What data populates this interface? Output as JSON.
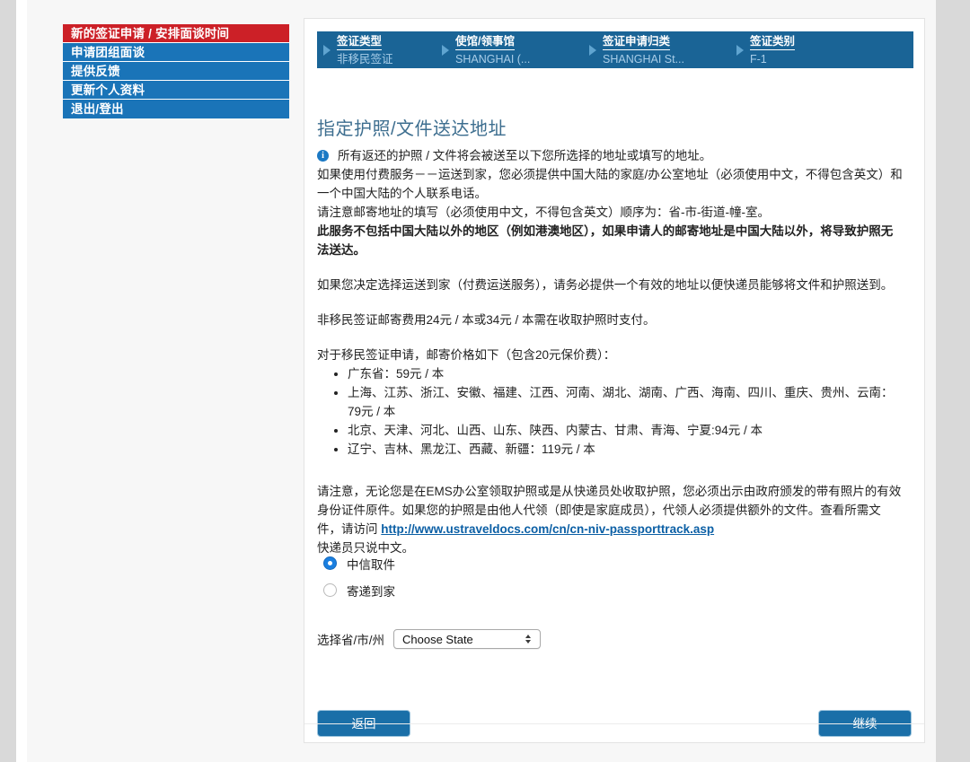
{
  "sidebar": {
    "items": [
      {
        "label": "新的签证申请 / 安排面谈时间",
        "active": true
      },
      {
        "label": "申请团组面谈",
        "active": false
      },
      {
        "label": "提供反馈",
        "active": false
      },
      {
        "label": "更新个人资料",
        "active": false
      },
      {
        "label": "退出/登出",
        "active": false
      }
    ]
  },
  "breadcrumb": {
    "steps": [
      {
        "title": "签证类型",
        "value": "非移民签证"
      },
      {
        "title": "使馆/领事馆",
        "value": "SHANGHAI (..."
      },
      {
        "title": "签证申请归类",
        "value": "SHANGHAI St..."
      },
      {
        "title": "签证类别",
        "value": "F-1"
      }
    ]
  },
  "main": {
    "page_title": "指定护照/文件送达地址",
    "info_icon": "info-icon",
    "info_text": "所有返还的护照 / 文件将会被送至以下您所选择的地址或填写的地址。",
    "para_paid_service": "如果使用付费服务－－运送到家，您必须提供中国大陆的家庭/办公室地址（必须使用中文，不得包含英文）和一个中国大陆的个人联系电话。",
    "para_address_order": "请注意邮寄地址的填写（必须使用中文，不得包含英文）顺序为：省-市-街道-幢-室。",
    "para_mainland_only": "此服务不包括中国大陆以外的地区（例如港澳地区），如果申请人的邮寄地址是中国大陆以外，将导致护照无法送达。",
    "para_valid_address": "如果您决定选择运送到家（付费运送服务），请务必提供一个有效的地址以便快递员能够将文件和护照送到。",
    "para_niv_fee": "非移民签证邮寄费用24元 / 本或34元 / 本需在收取护照时支付。",
    "para_iv_intro": "对于移民签证申请，邮寄价格如下（包含20元保价费）：",
    "price_list": [
      "广东省：59元 / 本",
      "上海、江苏、浙江、安徽、福建、江西、河南、湖北、湖南、广西、海南、四川、重庆、贵州、云南：79元 / 本",
      "北京、天津、河北、山西、山东、陕西、内蒙古、甘肃、青海、宁夏:94元 / 本",
      "辽宁、吉林、黑龙江、西藏、新疆：119元 / 本"
    ],
    "para_pickup_id": "请注意，无论您是在EMS办公室领取护照或是从快递员处收取护照，您必须出示由政府颁发的带有照片的有效身份证件原件。如果您的护照是由他人代领（即使是家庭成员），代领人必须提供额外的文件。查看所需文件，请访问",
    "track_link_text": "http://www.ustraveldocs.com/cn/cn-niv-passporttrack.asp",
    "para_courier_chinese": "快递员只说中文。"
  },
  "form": {
    "radio_options": [
      {
        "label": "中信取件",
        "selected": true
      },
      {
        "label": "寄递到家",
        "selected": false
      }
    ],
    "select_label": "选择省/市/州",
    "select_value": "Choose State"
  },
  "footer": {
    "back_label": "返回",
    "continue_label": "继续"
  },
  "colors": {
    "sidebar_blue": "#1a74b8",
    "sidebar_active_red": "#cc2027",
    "breadcrumb_blue": "#1a6496",
    "heading_blue": "#3d6e8f",
    "button_blue": "#1a6fa8",
    "link_blue": "#0b5fa5",
    "radio_selected": "#1a7fe0",
    "page_band_gray": "#d9d9d9"
  }
}
